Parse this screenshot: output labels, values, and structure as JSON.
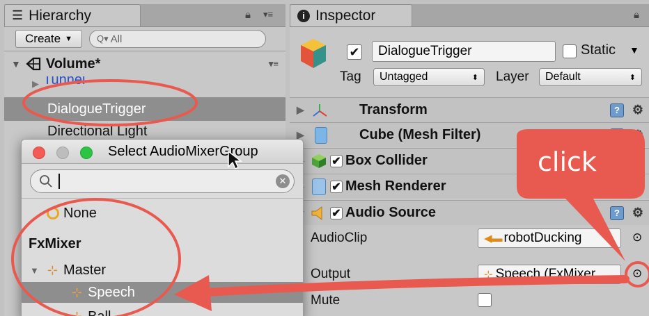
{
  "hierarchy": {
    "tab_label": "Hierarchy",
    "create_label": "Create",
    "search_placeholder": "All",
    "scene_name": "Volume*",
    "items": [
      "Tunnel",
      "DialogueTrigger",
      "Directional Light"
    ]
  },
  "popup": {
    "title": "Select AudioMixerGroup",
    "search_value": "",
    "none_label": "None",
    "mixer_name": "FxMixer",
    "master_label": "Master",
    "selected_label": "Speech",
    "next_label": "Ball"
  },
  "inspector": {
    "tab_label": "Inspector",
    "object_name": "DialogueTrigger",
    "static_label": "Static",
    "tag_label": "Tag",
    "tag_value": "Untagged",
    "layer_label": "Layer",
    "layer_value": "Default",
    "components": [
      "Transform",
      "Cube (Mesh Filter)",
      "Box Collider",
      "Mesh Renderer",
      "Audio Source"
    ],
    "audioclip_label": "AudioClip",
    "audioclip_value": "robotDucking",
    "output_label": "Output",
    "output_value": "Speech (FxMixer",
    "mute_label": "Mute"
  },
  "annotation": {
    "callout_text": "click",
    "color": "#e85a4f"
  }
}
